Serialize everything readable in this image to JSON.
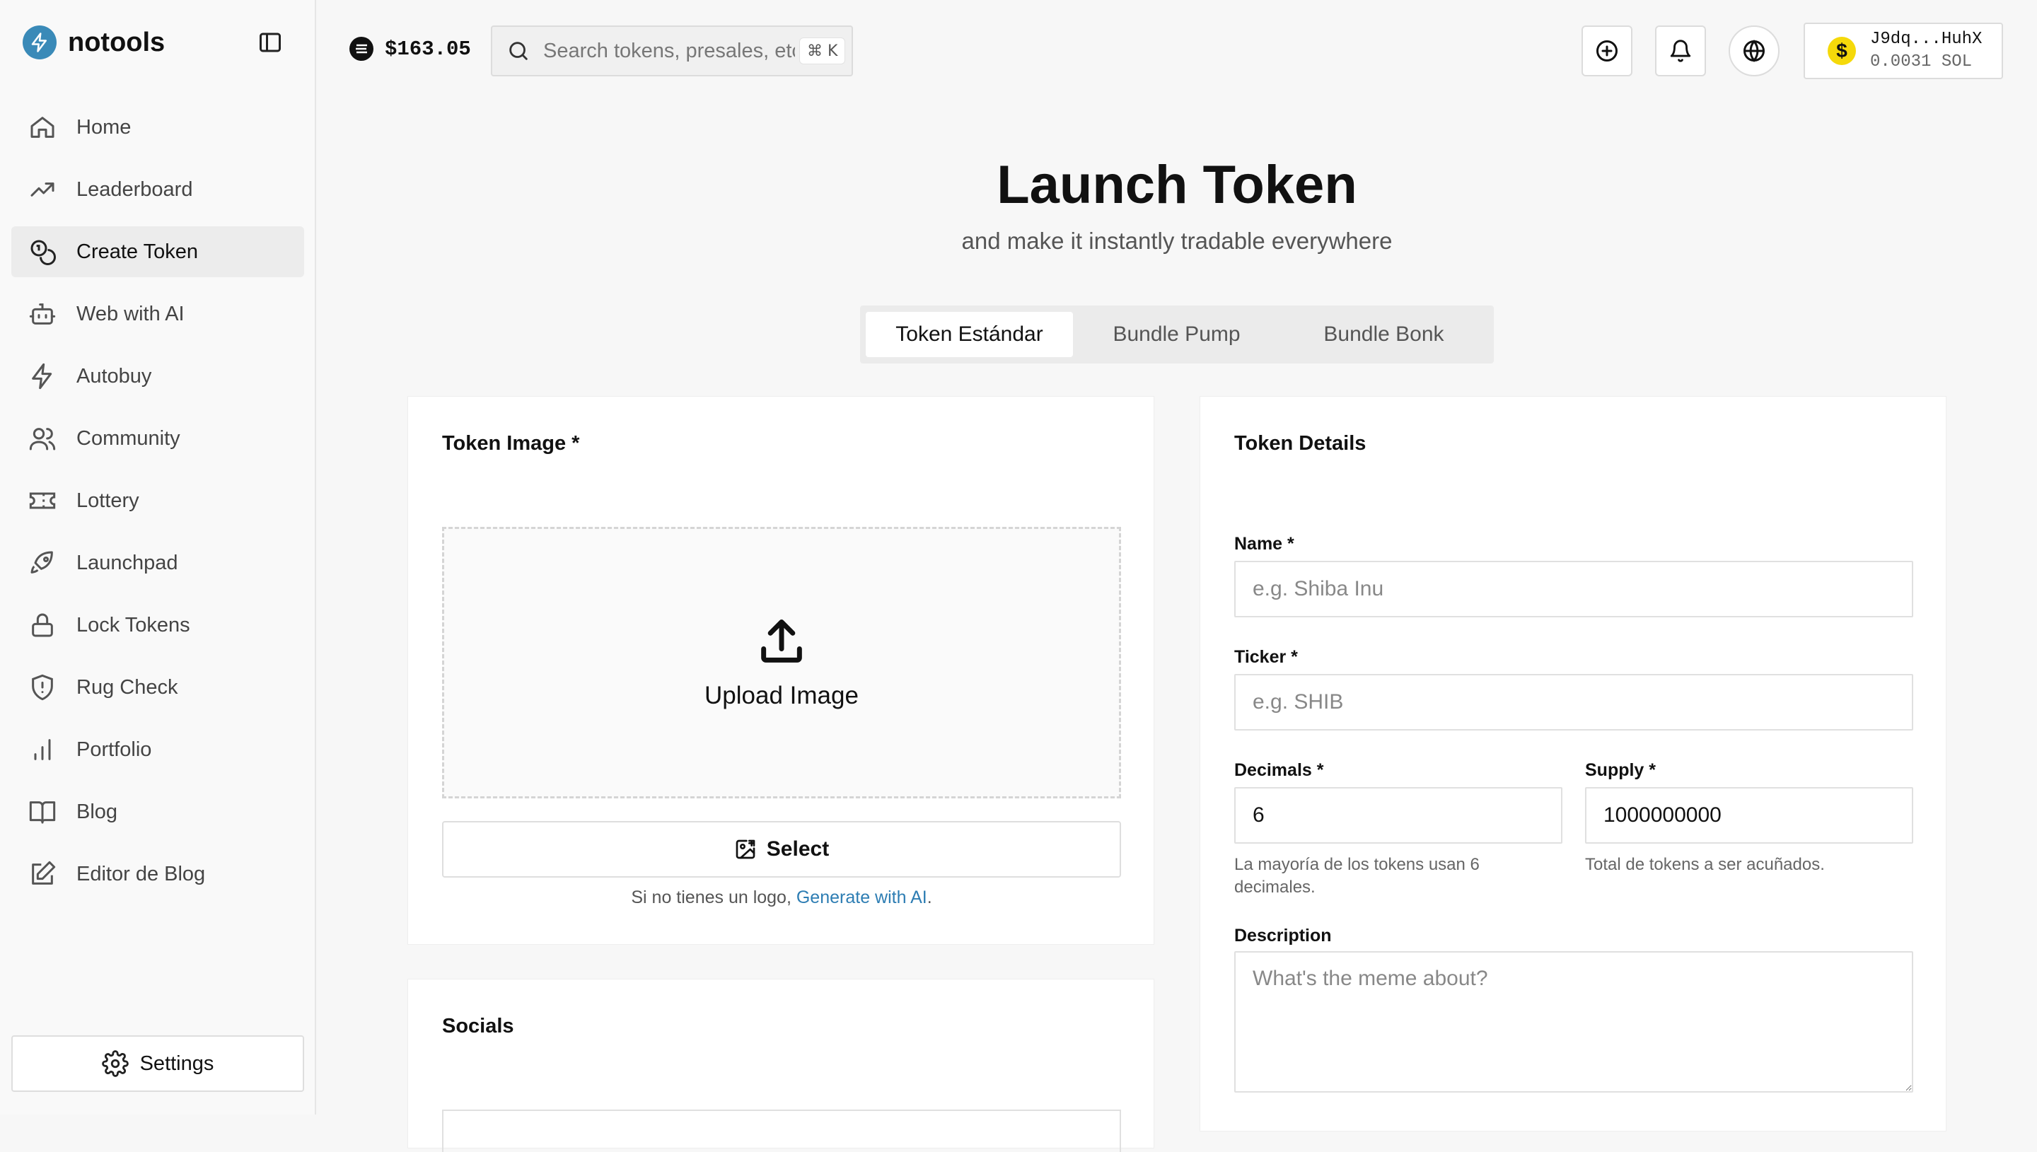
{
  "brand": {
    "name": "notools"
  },
  "nav": [
    {
      "key": "home",
      "label": "Home",
      "icon": "home-icon"
    },
    {
      "key": "leaderboard",
      "label": "Leaderboard",
      "icon": "trending-up-icon"
    },
    {
      "key": "create-token",
      "label": "Create Token",
      "icon": "coins-icon",
      "active": true
    },
    {
      "key": "web-with-ai",
      "label": "Web with AI",
      "icon": "bot-icon"
    },
    {
      "key": "autobuy",
      "label": "Autobuy",
      "icon": "zap-icon"
    },
    {
      "key": "community",
      "label": "Community",
      "icon": "users-icon"
    },
    {
      "key": "lottery",
      "label": "Lottery",
      "icon": "ticket-icon"
    },
    {
      "key": "launchpad",
      "label": "Launchpad",
      "icon": "rocket-icon"
    },
    {
      "key": "lock-tokens",
      "label": "Lock Tokens",
      "icon": "lock-icon"
    },
    {
      "key": "rug-check",
      "label": "Rug Check",
      "icon": "shield-alert-icon"
    },
    {
      "key": "portfolio",
      "label": "Portfolio",
      "icon": "bar-chart-icon"
    },
    {
      "key": "blog",
      "label": "Blog",
      "icon": "book-open-icon"
    },
    {
      "key": "editor-de-blog",
      "label": "Editor de Blog",
      "icon": "edit-icon"
    }
  ],
  "settings": {
    "label": "Settings"
  },
  "topbar": {
    "sol_price": "$163.05",
    "search_placeholder": "Search tokens, presales, etc",
    "search_shortcut": "⌘ K"
  },
  "wallet": {
    "address": "J9dq...HuhX",
    "balance": "0.0031 SOL"
  },
  "hero": {
    "title": "Launch Token",
    "subtitle": "and make it instantly tradable everywhere"
  },
  "tabs": [
    {
      "label": "Token Estándar",
      "active": true
    },
    {
      "label": "Bundle Pump",
      "active": false
    },
    {
      "label": "Bundle Bonk",
      "active": false
    }
  ],
  "image_card": {
    "title": "Token Image *",
    "upload_label": "Upload Image",
    "select_label": "Select",
    "hint_prefix": "Si no tienes un logo, ",
    "hint_link": "Generate with AI",
    "hint_suffix": "."
  },
  "socials_card": {
    "title": "Socials"
  },
  "details_card": {
    "title": "Token Details",
    "name_label": "Name *",
    "name_placeholder": "e.g. Shiba Inu",
    "ticker_label": "Ticker *",
    "ticker_placeholder": "e.g. SHIB",
    "decimals_label": "Decimals *",
    "decimals_value": "6",
    "decimals_help": "La mayoría de los tokens usan 6 decimales.",
    "supply_label": "Supply *",
    "supply_value": "1000000000",
    "supply_help": "Total de tokens a ser acuñados.",
    "description_label": "Description",
    "description_placeholder": "What's the meme about?"
  },
  "colors": {
    "accent": "#3a8ab8",
    "link": "#2d7db3",
    "sidebar_bg": "#f9f9f9",
    "page_bg": "#f7f7f7"
  }
}
